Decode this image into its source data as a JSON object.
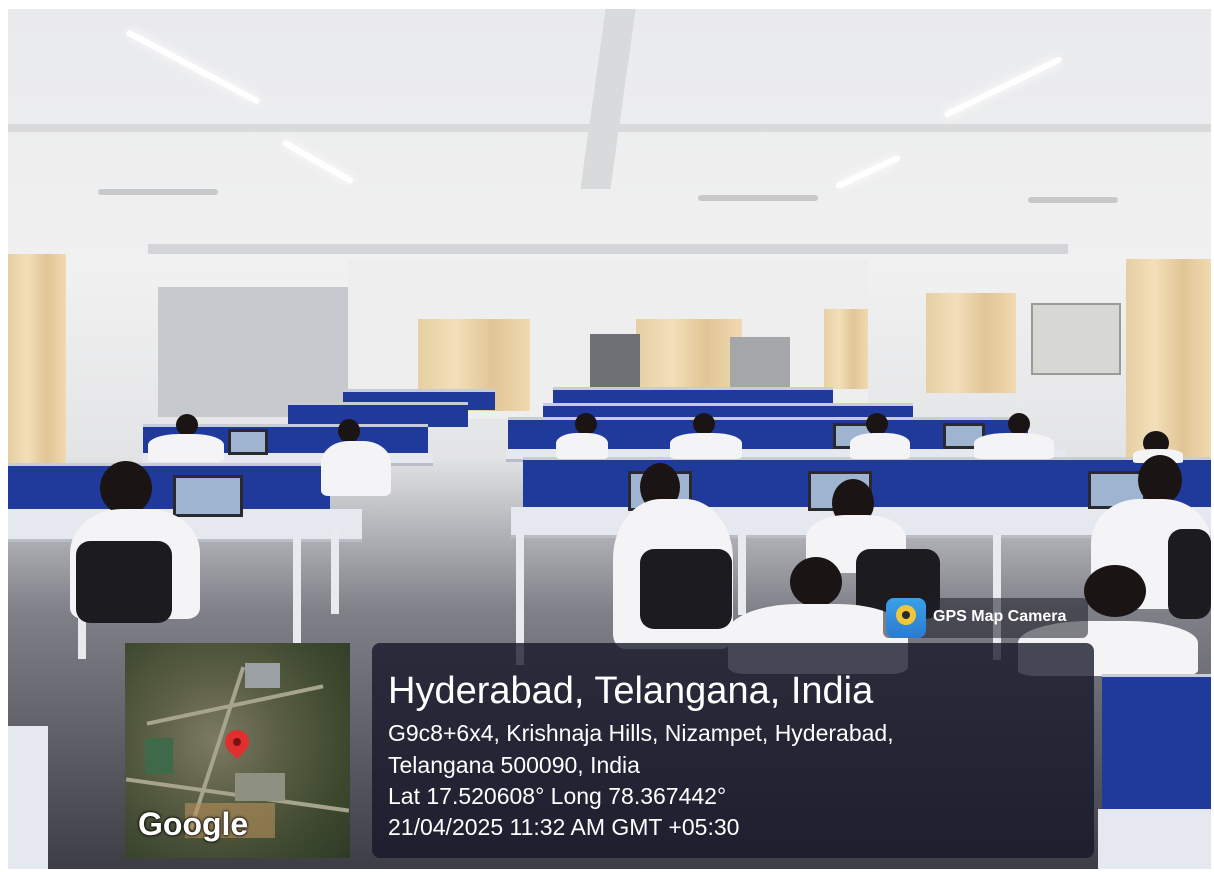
{
  "watermark": {
    "app_name": "GPS Map Camera",
    "app_icon": "map-pin-camera-icon",
    "map_brand": "Google",
    "title": "Hyderabad, Telangana, India",
    "address_line_1": "G9c8+6x4, Krishnaja Hills, Nizampet, Hyderabad,",
    "address_line_2": "Telangana 500090, India",
    "coordinates": "Lat 17.520608° Long 78.367442°",
    "datetime": "21/04/2025 11:32 AM GMT +05:30"
  },
  "colors": {
    "panel_bg": "#14162a",
    "cubicle_blue": "#203a9c",
    "pin_red": "#e02f2f"
  }
}
